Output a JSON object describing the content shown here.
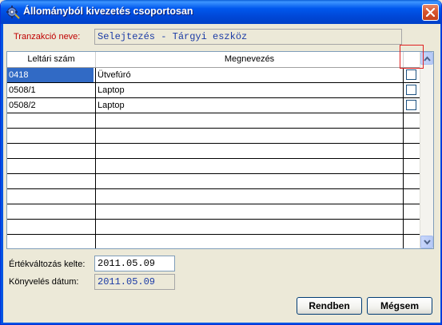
{
  "window": {
    "title": "Állományból kivezetés csoportosan",
    "icon": "gear-app-icon",
    "close": "close-icon"
  },
  "transaction": {
    "label": "Tranzakció neve:",
    "value": "Selejtezés - Tárgyi eszköz"
  },
  "grid": {
    "columns": [
      "Leltári szám",
      "Megnevezés",
      ""
    ],
    "rows": [
      {
        "code": "0418",
        "name": "Ütvefúró",
        "checked": false,
        "selected": true
      },
      {
        "code": "0508/1",
        "name": "Laptop",
        "checked": false,
        "selected": false
      },
      {
        "code": "0508/2",
        "name": "Laptop",
        "checked": false,
        "selected": false
      }
    ],
    "empty_rows": 9,
    "scroll_up": "scroll-up-icon",
    "scroll_down": "scroll-down-icon"
  },
  "value_change_date": {
    "label": "Értékváltozás kelte:",
    "value": "2011.05.09"
  },
  "posting_date": {
    "label": "Könyvelés dátum:",
    "value": "2011.05.09"
  },
  "buttons": {
    "ok": "Rendben",
    "cancel": "Mégsem"
  },
  "colors": {
    "titlebar": "#0054e3",
    "label_red": "#c00000",
    "field_text": "#1a3aa6",
    "selection": "#316ac5",
    "highlight": "#e02020"
  }
}
